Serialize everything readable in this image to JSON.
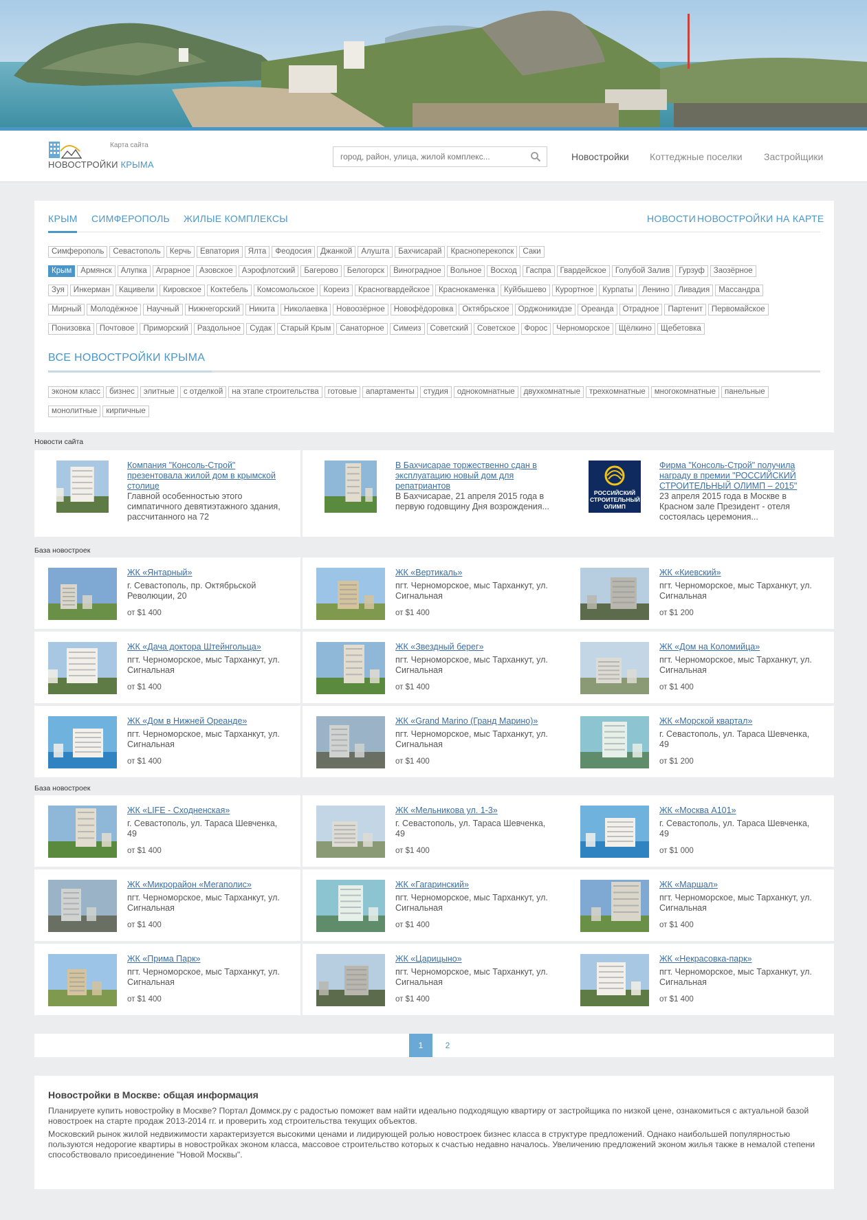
{
  "header": {
    "logo_text_1": "НОВОСТРОЙКИ",
    "logo_text_2": "КРЫМА",
    "sitemap": "Карта сайта",
    "search_placeholder": "город, район, улица, жилой комплекс...",
    "nav": [
      "Новостройки",
      "Коттеджные поселки",
      "Застройщики"
    ]
  },
  "tabs": {
    "left": [
      "КРЫМ",
      "СИМФЕРОПОЛЬ",
      "ЖИЛЫЕ КОМПЛЕКСЫ"
    ],
    "right": [
      "НОВОСТИ",
      "НОВОСТРОЙКИ НА КАРТЕ"
    ]
  },
  "locations": {
    "row1": [
      "Симферополь",
      "Севастополь",
      "Керчь",
      "Евпатория",
      "Ялта",
      "Феодосия",
      "Джанкой",
      "Алушта",
      "Бахчисарай",
      "Красноперекопск",
      "Саки"
    ],
    "row2": [
      "Крым",
      "Армянск",
      "Алупка",
      "Аграрное",
      "Азовское",
      "Аэрофлотский",
      "Багерово",
      "Белогорск",
      "Виноградное",
      "Вольное",
      "Восход",
      "Гаспра",
      "Гвардейское",
      "Голубой Залив",
      "Гурзуф",
      "Заозёрное"
    ],
    "row3": [
      "Зуя",
      "Инкерман",
      "Кацивели",
      "Кировское",
      "Коктебель",
      "Комсомольское",
      "Кореиз",
      "Красногвардейское",
      "Краснокаменка",
      "Куйбышево",
      "Курортное",
      "Курпаты",
      "Ленино",
      "Ливадия",
      "Массандра"
    ],
    "row4": [
      "Мирный",
      "Молодёжное",
      "Научный",
      "Нижнегорский",
      "Никита",
      "Николаевка",
      "Новоозёрное",
      "Новофёдоровка",
      "Октябрьское",
      "Орджоникидзе",
      "Ореанда",
      "Отрадное",
      "Партенит",
      "Первомайское"
    ],
    "row5": [
      "Понизовка",
      "Почтовое",
      "Приморский",
      "Раздольное",
      "Судак",
      "Старый Крым",
      "Санаторное",
      "Симеиз",
      "Советский",
      "Советское",
      "Форос",
      "Черноморское",
      "Щёлкино",
      "Щебетовка"
    ],
    "selected": "Крым"
  },
  "all_title": "ВСЕ НОВОСТРОЙКИ КРЫМА",
  "filters": {
    "row1": [
      "эконом класс",
      "бизнес",
      "элитные",
      "с отделкой",
      "на этапе строительства",
      "готовые",
      "апартаменты",
      "студия",
      "однокомнатные",
      "двухкомнатные",
      "трехкомнатные",
      "многокомнатные",
      "панельные"
    ],
    "row2": [
      "монолитные",
      "кирпичные"
    ]
  },
  "news_label": "Новости сайта",
  "news": [
    {
      "title": "Компания \"Консоль-Строй\" презентовала жилой дом в крымской столице",
      "text": "Главной особенностью этого симпатичного девятиэтажного здания, рассчитанного на 72"
    },
    {
      "title": "В Бахчисарае торжественно сдан в эксплуатацию новый дом для репатриантов",
      "text": "В Бахчисарае, 21 апреля 2015 года в первую годовщину Дня возрождения..."
    },
    {
      "title": "Фирма \"Консоль-Строй\" получила награду в премии \"РОССИЙСКИЙ СТРОИТЕЛЬНЫЙ ОЛИМП – 2015\"",
      "text": "23 апреля 2015 года в Москве в Красном зале Президент - отеля состоялась церемония...",
      "logo_text": "РОССИЙСКИЙ СТРОИТЕЛЬНЫЙ ОЛИМП"
    }
  ],
  "base1_label": "База новостроек",
  "base1": [
    {
      "title": "ЖК «Янтарный»",
      "addr": "г. Севастополь, пр. Октябрьской Революции, 20",
      "price": "от $1 400"
    },
    {
      "title": "ЖК «Вертикаль»",
      "addr": "пгт. Черноморское, мыс Тарханкут, ул. Сигнальная",
      "price": "от $1 400"
    },
    {
      "title": "ЖК «Киевский»",
      "addr": "пгт. Черноморское, мыс Тарханкут, ул. Сигнальная",
      "price": "от $1 200"
    },
    {
      "title": "ЖК «Дача доктора Штейнгольца»",
      "addr": "пгт. Черноморское, мыс Тарханкут, ул. Сигнальная",
      "price": "от $1 400"
    },
    {
      "title": "ЖК «Звездный берег»",
      "addr": "пгт. Черноморское, мыс Тарханкут, ул. Сигнальная",
      "price": "от $1 400"
    },
    {
      "title": "ЖК «Дом на Коломийца»",
      "addr": "пгт. Черноморское, мыс Тарханкут, ул. Сигнальная",
      "price": "от $1 400"
    },
    {
      "title": "ЖК «Дом в Нижней Ореанде»",
      "addr": "пгт. Черноморское, мыс Тарханкут, ул. Сигнальная",
      "price": "от $1 400"
    },
    {
      "title": "ЖК «Grand Marino (Гранд Марино)»",
      "addr": "пгт. Черноморское, мыс Тарханкут, ул. Сигнальная",
      "price": "от $1 400"
    },
    {
      "title": "ЖК «Морской квартал»",
      "addr": "г. Севастополь, ул. Тараса Шевченка, 49",
      "price": "от $1 200"
    }
  ],
  "base2_label": "База новостроек",
  "base2": [
    {
      "title": "ЖК «LIFE - Сходненская»",
      "addr": "г. Севастополь, ул. Тараса Шевченка, 49",
      "price": "от $1 400"
    },
    {
      "title": "ЖК «Мельникова ул. 1-3»",
      "addr": "г. Севастополь, ул. Тараса Шевченка, 49",
      "price": "от $1 400"
    },
    {
      "title": "ЖК «Москва А101»",
      "addr": "г. Севастополь, ул. Тараса Шевченка, 49",
      "price": "от $1 000"
    },
    {
      "title": "ЖК «Микрорайон «Мегаполис»",
      "addr": "пгт. Черноморское, мыс Тарханкут, ул. Сигнальная",
      "price": "от $1 400"
    },
    {
      "title": "ЖК «Гагаринский»",
      "addr": "пгт. Черноморское, мыс Тарханкут, ул. Сигнальная",
      "price": "от $1 400"
    },
    {
      "title": "ЖК «Маршал»",
      "addr": "пгт. Черноморское, мыс Тарханкут, ул. Сигнальная",
      "price": "от $1 400"
    },
    {
      "title": "ЖК «Прима Парк»",
      "addr": "пгт. Черноморское, мыс Тарханкут, ул. Сигнальная",
      "price": "от $1 400"
    },
    {
      "title": "ЖК «Царицыно»",
      "addr": "пгт. Черноморское, мыс Тарханкут, ул. Сигнальная",
      "price": "от $1 400"
    },
    {
      "title": "ЖК «Некрасовка-парк»",
      "addr": "пгт. Черноморское, мыс Тарханкут, ул. Сигнальная",
      "price": "от $1 400"
    }
  ],
  "pagination": {
    "pages": [
      "1",
      "2"
    ],
    "current": "1"
  },
  "info": {
    "title": "Новостройки в Москве: общая информация",
    "p1": "Планируете купить новостройку в Москве? Портал Доммск.ру с радостью поможет вам найти идеально подходящую квартиру от застройщика по низкой цене, ознакомиться с актуальной базой новостроек на старте продаж 2013-2014 гг. и проверить ход строительства текущих объектов.",
    "p2": "Московский рынок жилой недвижимости характеризуется высокими ценами и лидирующей ролью новостроек бизнес класса в структуре предложений. Однако наибольшей популярностью пользуются недорогие квартиры в новостройках эконом класса, массовое строительство которых к счастью недавно началось. Увеличению предложений эконом жилья также в немалой степени способствовало присоединение \"Новой Москвы\"."
  },
  "colors": {
    "accent": "#4a96c8",
    "link": "#3a6ea5",
    "background": "#ecedef"
  }
}
